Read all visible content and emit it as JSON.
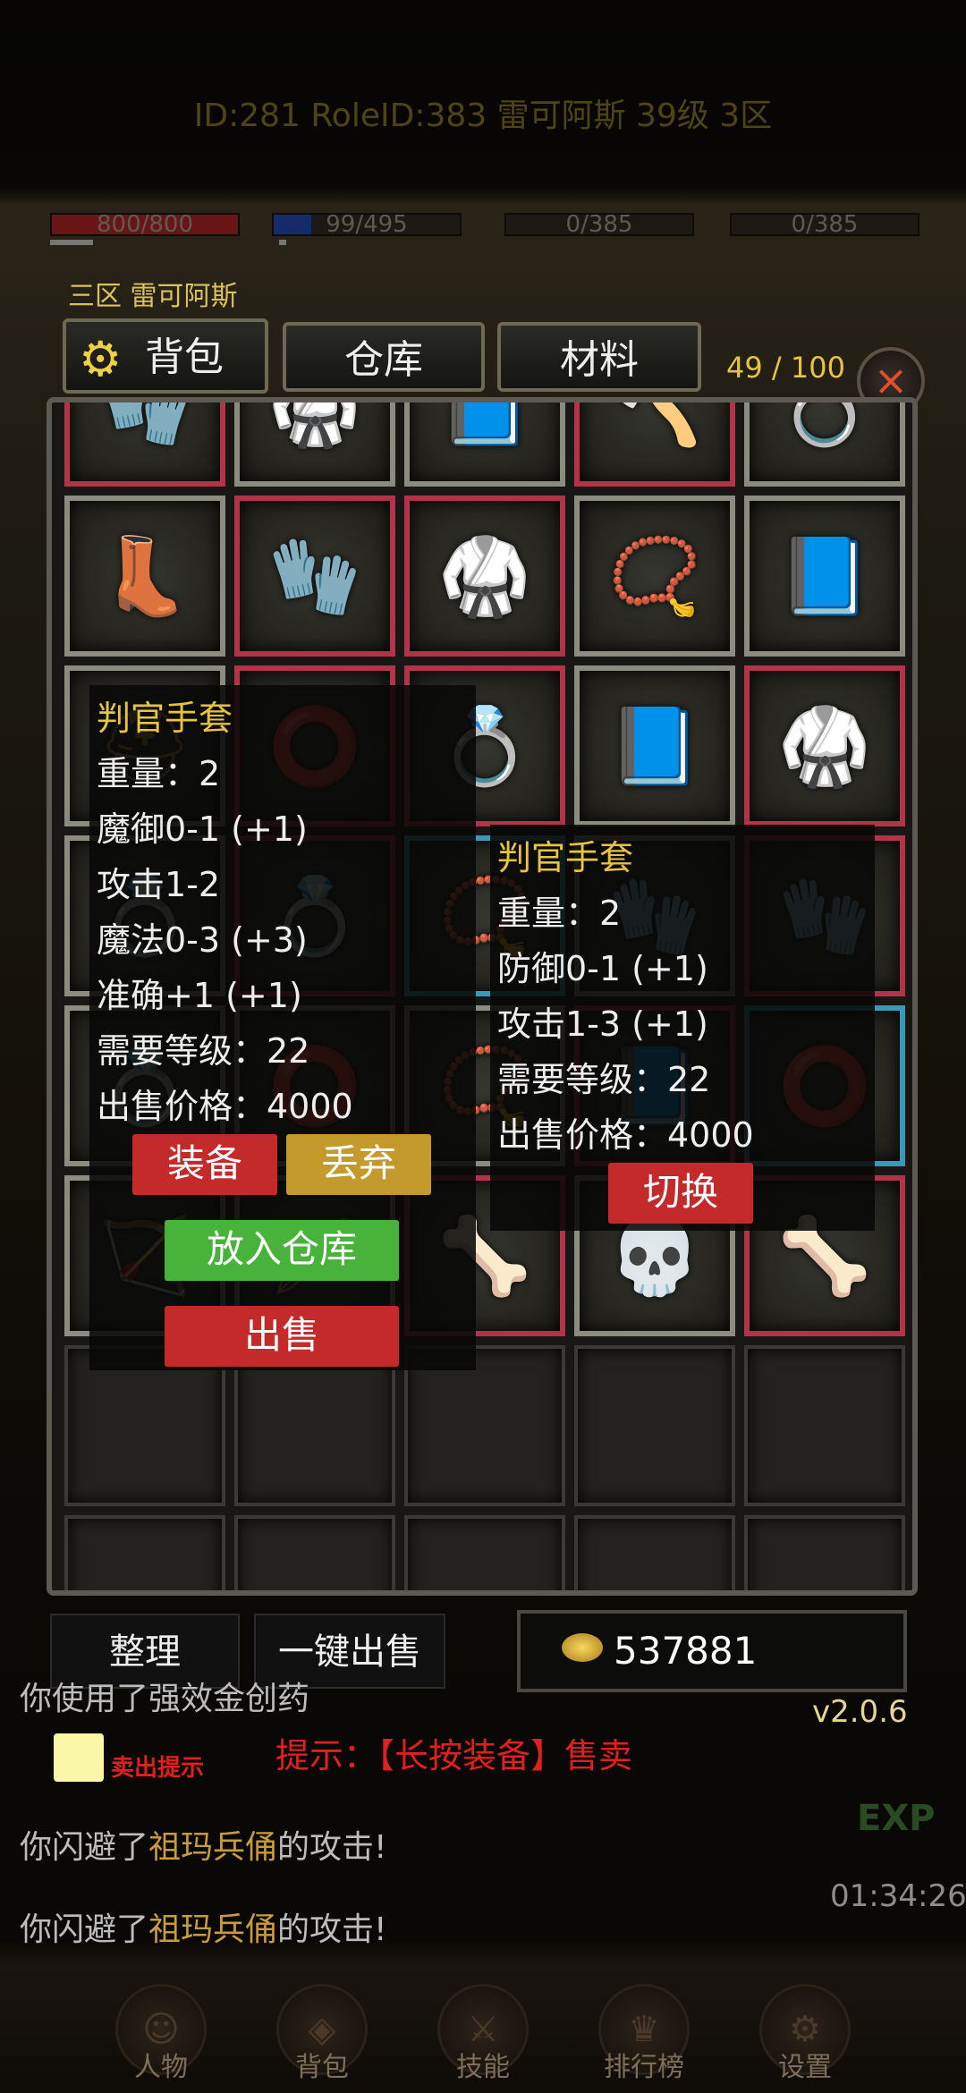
{
  "header": {
    "text": "ID:281  RoleID:383  雷可阿斯  39级  3区"
  },
  "bars": [
    {
      "label": "800/800",
      "fill": 1.0,
      "color": "#6a1515"
    },
    {
      "label": "99/495",
      "fill": 0.2,
      "color": "#152b6a"
    },
    {
      "label": "0/385",
      "fill": 0,
      "color": "#333"
    },
    {
      "label": "0/385",
      "fill": 0,
      "color": "#333"
    }
  ],
  "role_line": "三区  雷可阿斯",
  "tabs": {
    "bag": "背包",
    "warehouse": "仓库",
    "materials": "材料"
  },
  "counter": "49 / 100",
  "close_label": "×",
  "grid_rows": [
    [
      {
        "c": "red",
        "icon": "bracer-icon",
        "g": "🧤"
      },
      {
        "c": "gray",
        "icon": "armor-icon",
        "g": "🥋"
      },
      {
        "c": "gray",
        "icon": "book-icon",
        "g": "📘"
      },
      {
        "c": "red",
        "icon": "axe-icon",
        "g": "🪓"
      },
      {
        "c": "gray",
        "icon": "ring-icon",
        "g": "💍"
      }
    ],
    [
      {
        "c": "gray",
        "icon": "boots-icon",
        "g": "👢"
      },
      {
        "c": "red",
        "icon": "gauntlet-icon",
        "g": "🧤"
      },
      {
        "c": "red",
        "icon": "robe-icon",
        "g": "🥋"
      },
      {
        "c": "gray",
        "icon": "necklace-icon",
        "g": "📿"
      },
      {
        "c": "gray",
        "icon": "book-icon",
        "g": "📘"
      }
    ],
    [
      {
        "c": "gray",
        "icon": "helmet-icon",
        "g": "⛑"
      },
      {
        "c": "red",
        "icon": "bracelet-icon",
        "g": "⭕"
      },
      {
        "c": "red",
        "icon": "ring-icon",
        "g": "💍"
      },
      {
        "c": "gray",
        "icon": "book-icon",
        "g": "📘"
      },
      {
        "c": "red",
        "icon": "robe-icon",
        "g": "🥋"
      }
    ],
    [
      {
        "c": "gray",
        "icon": "ring-icon",
        "g": "💍"
      },
      {
        "c": "red",
        "icon": "ring-icon",
        "g": "💍"
      },
      {
        "c": "cyan",
        "icon": "necklace-icon",
        "g": "📿"
      },
      {
        "c": "gray",
        "icon": "bracer-icon",
        "g": "🧤"
      },
      {
        "c": "red",
        "icon": "bracer-icon",
        "g": "🧤"
      }
    ],
    [
      {
        "c": "gray",
        "icon": "ring-icon",
        "g": "💍"
      },
      {
        "c": "gray",
        "icon": "bracelet-icon",
        "g": "⭕"
      },
      {
        "c": "gray",
        "icon": "necklace-icon",
        "g": "📿"
      },
      {
        "c": "red",
        "icon": "book-icon",
        "g": "📘"
      },
      {
        "c": "cyan",
        "icon": "bracelet-icon",
        "g": "⭕"
      }
    ],
    [
      {
        "c": "gray",
        "icon": "bow-icon",
        "g": "🏹"
      },
      {
        "c": "gray",
        "icon": "sword-icon",
        "g": "🗡"
      },
      {
        "c": "red",
        "icon": "skeleton-glove-icon",
        "g": "🦴"
      },
      {
        "c": "gray",
        "icon": "skull-bracelet-icon",
        "g": "💀"
      },
      {
        "c": "red",
        "icon": "skeleton-glove-icon",
        "g": "🦴"
      }
    ],
    [
      {
        "c": "empty",
        "icon": "",
        "g": ""
      },
      {
        "c": "empty",
        "icon": "",
        "g": ""
      },
      {
        "c": "empty",
        "icon": "",
        "g": ""
      },
      {
        "c": "empty",
        "icon": "",
        "g": ""
      },
      {
        "c": "empty",
        "icon": "",
        "g": ""
      }
    ],
    [
      {
        "c": "empty",
        "icon": "",
        "g": ""
      },
      {
        "c": "empty",
        "icon": "",
        "g": ""
      },
      {
        "c": "empty",
        "icon": "",
        "g": ""
      },
      {
        "c": "empty",
        "icon": "",
        "g": ""
      },
      {
        "c": "empty",
        "icon": "",
        "g": ""
      }
    ]
  ],
  "tooltip1": {
    "title": "判官手套",
    "weight": "重量：2",
    "magic_def": "魔御0-1 (+1)",
    "attack": "攻击1-2",
    "magic": "魔法0-3 (+3)",
    "accuracy": "准确+1 (+1)",
    "req_level": "需要等级：22",
    "price": "出售价格：4000",
    "equip": "装备",
    "discard": "丢弃",
    "store": "放入仓库",
    "sell": "出售"
  },
  "tooltip2": {
    "title": "判官手套",
    "weight": "重量：2",
    "defense": "防御0-1 (+1)",
    "attack": "攻击1-3 (+1)",
    "req_level": "需要等级：22",
    "price": "出售价格：4000",
    "switch": "切换"
  },
  "bottom": {
    "sort": "整理",
    "sell_all": "一键出售",
    "gold": "537881",
    "version": "v2.0.6"
  },
  "sell_hint_label": "卖出提示",
  "hint": "提示：【长按装备】售卖",
  "log": {
    "line1": "你使用了强效金创药",
    "line2_a": "你闪避了",
    "line2_b": "祖玛兵俑",
    "line2_c": "的攻击!",
    "line3_a": "你闪避了",
    "line3_b": "祖玛兵俑",
    "line3_c": "的攻击!"
  },
  "timer": "01:34:26",
  "exp": "EXP",
  "nav": {
    "char": "人物",
    "bag": "背包",
    "skill": "技能",
    "rank": "排行榜",
    "settings": "设置"
  }
}
